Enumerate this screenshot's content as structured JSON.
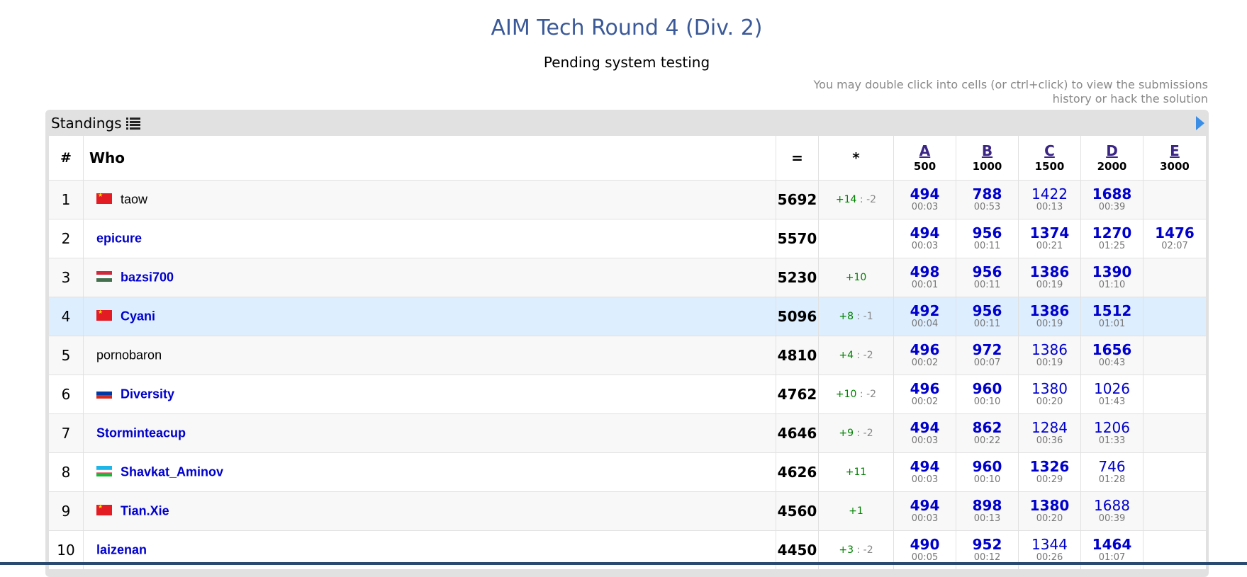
{
  "header": {
    "title": "AIM Tech Round 4 (Div. 2)",
    "status": "Pending system testing",
    "hint_line1": "You may double click into cells (or ctrl+click) to view the submissions",
    "hint_line2": "history or hack the solution"
  },
  "panel": {
    "title": "Standings",
    "icons": [
      "list-icon",
      "arrow-right-icon"
    ]
  },
  "columns": {
    "rank": "#",
    "who": "Who",
    "points": "=",
    "hacks": "*",
    "problems": [
      {
        "letter": "A",
        "points": "500"
      },
      {
        "letter": "B",
        "points": "1000"
      },
      {
        "letter": "C",
        "points": "1500"
      },
      {
        "letter": "D",
        "points": "2000"
      },
      {
        "letter": "E",
        "points": "3000"
      }
    ]
  },
  "rows": [
    {
      "rank": "1",
      "name": "taow",
      "flag": "cn",
      "color": "black",
      "points": "5692",
      "hack_plus": "+14",
      "hack_minus": "-2",
      "cells": [
        {
          "s": "494",
          "t": "00:03",
          "b": true
        },
        {
          "s": "788",
          "t": "00:53",
          "b": true
        },
        {
          "s": "1422",
          "t": "00:13",
          "b": false
        },
        {
          "s": "1688",
          "t": "00:39",
          "b": true
        },
        {
          "s": "",
          "t": "",
          "b": false
        }
      ]
    },
    {
      "rank": "2",
      "name": "epicure",
      "flag": "",
      "color": "blue",
      "points": "5570",
      "hack_plus": "",
      "hack_minus": "",
      "cells": [
        {
          "s": "494",
          "t": "00:03",
          "b": true
        },
        {
          "s": "956",
          "t": "00:11",
          "b": true
        },
        {
          "s": "1374",
          "t": "00:21",
          "b": true
        },
        {
          "s": "1270",
          "t": "01:25",
          "b": true
        },
        {
          "s": "1476",
          "t": "02:07",
          "b": true
        }
      ]
    },
    {
      "rank": "3",
      "name": "bazsi700",
      "flag": "hu",
      "color": "blue",
      "points": "5230",
      "hack_plus": "+10",
      "hack_minus": "",
      "cells": [
        {
          "s": "498",
          "t": "00:01",
          "b": true
        },
        {
          "s": "956",
          "t": "00:11",
          "b": true
        },
        {
          "s": "1386",
          "t": "00:19",
          "b": true
        },
        {
          "s": "1390",
          "t": "01:10",
          "b": true
        },
        {
          "s": "",
          "t": "",
          "b": false
        }
      ]
    },
    {
      "rank": "4",
      "name": "Cyani",
      "flag": "cn",
      "color": "blue",
      "points": "5096",
      "hack_plus": "+8",
      "hack_minus": "-1",
      "cells": [
        {
          "s": "492",
          "t": "00:04",
          "b": true
        },
        {
          "s": "956",
          "t": "00:11",
          "b": true
        },
        {
          "s": "1386",
          "t": "00:19",
          "b": true
        },
        {
          "s": "1512",
          "t": "01:01",
          "b": true
        },
        {
          "s": "",
          "t": "",
          "b": false
        }
      ]
    },
    {
      "rank": "5",
      "name": "pornobaron",
      "flag": "",
      "color": "black",
      "points": "4810",
      "hack_plus": "+4",
      "hack_minus": "-2",
      "cells": [
        {
          "s": "496",
          "t": "00:02",
          "b": true
        },
        {
          "s": "972",
          "t": "00:07",
          "b": true
        },
        {
          "s": "1386",
          "t": "00:19",
          "b": false
        },
        {
          "s": "1656",
          "t": "00:43",
          "b": true
        },
        {
          "s": "",
          "t": "",
          "b": false
        }
      ]
    },
    {
      "rank": "6",
      "name": "Diversity",
      "flag": "ru",
      "color": "blue",
      "points": "4762",
      "hack_plus": "+10",
      "hack_minus": "-2",
      "cells": [
        {
          "s": "496",
          "t": "00:02",
          "b": true
        },
        {
          "s": "960",
          "t": "00:10",
          "b": true
        },
        {
          "s": "1380",
          "t": "00:20",
          "b": false
        },
        {
          "s": "1026",
          "t": "01:43",
          "b": false
        },
        {
          "s": "",
          "t": "",
          "b": false
        }
      ]
    },
    {
      "rank": "7",
      "name": "Storminteacup",
      "flag": "",
      "color": "blue",
      "points": "4646",
      "hack_plus": "+9",
      "hack_minus": "-2",
      "cells": [
        {
          "s": "494",
          "t": "00:03",
          "b": true
        },
        {
          "s": "862",
          "t": "00:22",
          "b": true
        },
        {
          "s": "1284",
          "t": "00:36",
          "b": false
        },
        {
          "s": "1206",
          "t": "01:33",
          "b": false
        },
        {
          "s": "",
          "t": "",
          "b": false
        }
      ]
    },
    {
      "rank": "8",
      "name": "Shavkat_Aminov",
      "flag": "uz",
      "color": "blue",
      "points": "4626",
      "hack_plus": "+11",
      "hack_minus": "",
      "cells": [
        {
          "s": "494",
          "t": "00:03",
          "b": true
        },
        {
          "s": "960",
          "t": "00:10",
          "b": true
        },
        {
          "s": "1326",
          "t": "00:29",
          "b": true
        },
        {
          "s": "746",
          "t": "01:28",
          "b": false
        },
        {
          "s": "",
          "t": "",
          "b": false
        }
      ]
    },
    {
      "rank": "9",
      "name": "Tian.Xie",
      "flag": "cn",
      "color": "blue",
      "points": "4560",
      "hack_plus": "+1",
      "hack_minus": "",
      "cells": [
        {
          "s": "494",
          "t": "00:03",
          "b": true
        },
        {
          "s": "898",
          "t": "00:13",
          "b": true
        },
        {
          "s": "1380",
          "t": "00:20",
          "b": true
        },
        {
          "s": "1688",
          "t": "00:39",
          "b": false
        },
        {
          "s": "",
          "t": "",
          "b": false
        }
      ]
    },
    {
      "rank": "10",
      "name": "laizenan",
      "flag": "",
      "color": "blue",
      "points": "4450",
      "hack_plus": "+3",
      "hack_minus": "-2",
      "cells": [
        {
          "s": "490",
          "t": "00:05",
          "b": true
        },
        {
          "s": "952",
          "t": "00:12",
          "b": true
        },
        {
          "s": "1344",
          "t": "00:26",
          "b": false
        },
        {
          "s": "1464",
          "t": "01:07",
          "b": true
        },
        {
          "s": "",
          "t": "",
          "b": false
        }
      ]
    }
  ],
  "highlighted_row": "4"
}
